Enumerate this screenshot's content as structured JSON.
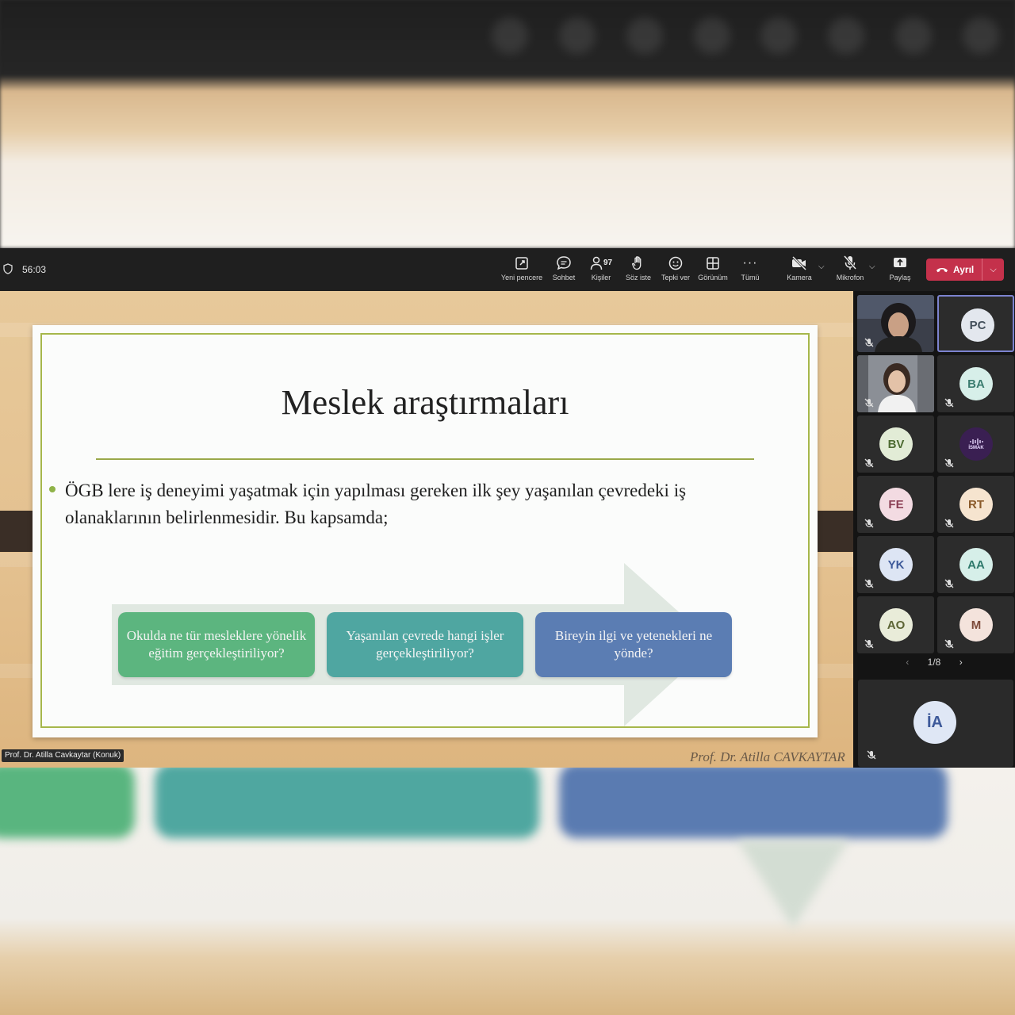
{
  "call": {
    "timer": "56:03"
  },
  "toolbar": {
    "new_window": "Yeni pencere",
    "chat": "Sohbet",
    "people_count": "97",
    "people": "Kişiler",
    "raise_hand": "Söz iste",
    "react": "Tepki ver",
    "view": "Görünüm",
    "more": "Tümü",
    "camera": "Kamera",
    "mic": "Mikrofon",
    "share": "Paylaş",
    "leave": "Ayrıl"
  },
  "slide": {
    "title": "Meslek araştırmaları",
    "bullet": "ÖGB lere iş deneyimi yaşatmak için yapılması gereken ilk şey yaşanılan çevredeki iş olanaklarının belirlenmesidir. Bu kapsamda;",
    "boxes": [
      "Okulda ne tür mesleklere yönelik eğitim gerçekleştiriliyor?",
      "Yaşanılan çevrede hangi işler gerçekleştiriliyor?",
      "Bireyin ilgi ve yetenekleri ne yönde?"
    ],
    "signature": "Prof. Dr. Atilla CAVKAYTAR"
  },
  "presenter": {
    "name": "Prof. Dr. Atilla Cavkaytar (Konuk)"
  },
  "participants": {
    "tiles": [
      {
        "initials": "PC",
        "bg": "#e3e7ee",
        "fg": "#44505c"
      },
      {
        "initials": "BA",
        "bg": "#d7efe9",
        "fg": "#3b7d70"
      },
      {
        "initials": "BV",
        "bg": "#e2ecd6",
        "fg": "#4d6b32"
      },
      {
        "initials": "FE",
        "bg": "#f3dbe2",
        "fg": "#8a3e54"
      },
      {
        "initials": "RT",
        "bg": "#f6e4cf",
        "fg": "#8a5a2a"
      },
      {
        "initials": "YK",
        "bg": "#dde5f4",
        "fg": "#3e5a9a"
      },
      {
        "initials": "AA",
        "bg": "#d6efe9",
        "fg": "#2f7a6c"
      },
      {
        "initials": "AO",
        "bg": "#e9ecd9",
        "fg": "#5c6434"
      },
      {
        "initials": "M",
        "bg": "#f4e3dc",
        "fg": "#7d4a3a"
      }
    ],
    "logo_text": "İSMAK",
    "page": "1/8",
    "featured_initials": "İA"
  },
  "colors": {
    "leave_red": "#c4314b",
    "slide_border": "#a6b74b",
    "box_green": "#5cb57f",
    "box_teal": "#4fa6a1",
    "box_blue": "#5b7db3"
  }
}
